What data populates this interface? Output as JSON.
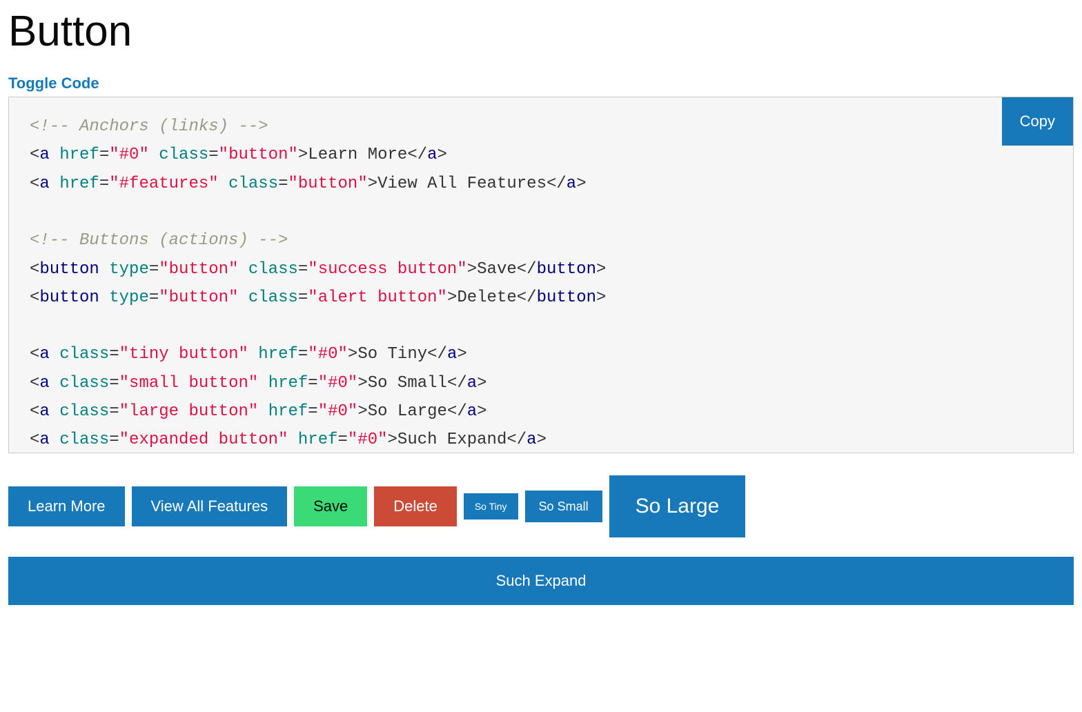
{
  "title": "Button",
  "toggle_label": "Toggle Code",
  "copy_label": "Copy",
  "code": {
    "comment_anchors": "<!-- Anchors (links) -->",
    "line1": {
      "tag": "a",
      "href": "\"#0\"",
      "class": "\"button\"",
      "text": "Learn More"
    },
    "line2": {
      "tag": "a",
      "href": "\"#features\"",
      "class": "\"button\"",
      "text": "View All Features"
    },
    "comment_buttons": "<!-- Buttons (actions) -->",
    "line3": {
      "tag": "button",
      "type": "\"button\"",
      "class": "\"success button\"",
      "text": "Save"
    },
    "line4": {
      "tag": "button",
      "type": "\"button\"",
      "class": "\"alert button\"",
      "text": "Delete"
    },
    "line5": {
      "tag": "a",
      "class": "\"tiny button\"",
      "href": "\"#0\"",
      "text": "So Tiny"
    },
    "line6": {
      "tag": "a",
      "class": "\"small button\"",
      "href": "\"#0\"",
      "text": "So Small"
    },
    "line7": {
      "tag": "a",
      "class": "\"large button\"",
      "href": "\"#0\"",
      "text": "So Large"
    },
    "line8": {
      "tag": "a",
      "class": "\"expanded button\"",
      "href": "\"#0\"",
      "text": "Such Expand"
    },
    "href_label": "href",
    "class_label": "class",
    "type_label": "type",
    "eq": "=",
    "lt": "<",
    "gt": ">",
    "lts": "</",
    "sp": " "
  },
  "buttons": {
    "learn_more": "Learn More",
    "view_all": "View All Features",
    "save": "Save",
    "delete": "Delete",
    "tiny": "So Tiny",
    "small": "So Small",
    "large": "So Large",
    "expand": "Such Expand"
  }
}
